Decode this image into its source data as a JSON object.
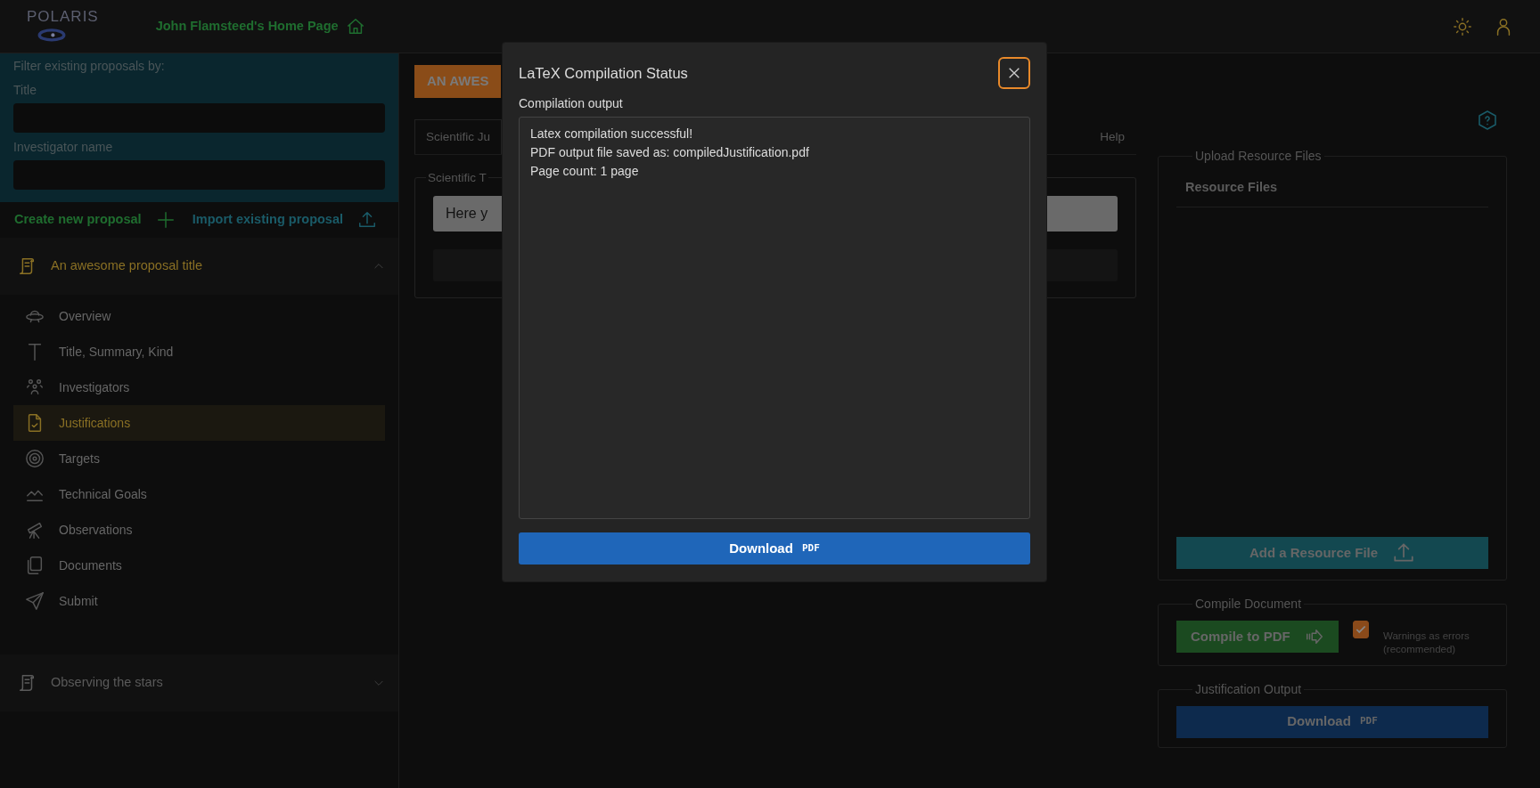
{
  "header": {
    "logo": "POLARIS",
    "home_link": "John Flamsteed's Home Page"
  },
  "filter": {
    "heading": "Filter existing proposals by:",
    "fields": [
      {
        "label": "Title"
      },
      {
        "label": "Investigator name"
      }
    ]
  },
  "actions": [
    {
      "label": "Create new proposal",
      "kind": "create"
    },
    {
      "label": "Import existing proposal",
      "kind": "import"
    }
  ],
  "proposals": [
    {
      "title": "An awesome proposal title",
      "expanded": true,
      "children": [
        {
          "label": "Overview",
          "kind": "ufo",
          "selected": false
        },
        {
          "label": "Title, Summary, Kind",
          "kind": "text",
          "selected": false
        },
        {
          "label": "Investigators",
          "kind": "people",
          "selected": false
        },
        {
          "label": "Justifications",
          "kind": "file-check",
          "selected": true
        },
        {
          "label": "Targets",
          "kind": "target",
          "selected": false
        },
        {
          "label": "Technical Goals",
          "kind": "chart",
          "selected": false
        },
        {
          "label": "Observations",
          "kind": "telescope",
          "selected": false
        },
        {
          "label": "Documents",
          "kind": "copy",
          "selected": false
        },
        {
          "label": "Submit",
          "kind": "send",
          "selected": false
        }
      ]
    },
    {
      "title": "Observing the stars",
      "expanded": false
    }
  ],
  "main": {
    "banner": "AN AWES",
    "tabs": [
      {
        "label": "Scientific Ju",
        "selected": true
      },
      {
        "label": "Help",
        "selected": false
      }
    ],
    "legend": "Scientific T",
    "editor_value": "Here y"
  },
  "resources": {
    "legend": "Upload Resource Files",
    "column": "Resource Files",
    "button": "Add a Resource File"
  },
  "compile": {
    "legend": "Compile Document",
    "button": "Compile to PDF",
    "warnings": {
      "label": "Warnings as errors (recommended)",
      "checked": true
    }
  },
  "output": {
    "legend": "Justification Output",
    "button": "Download",
    "badge": "PDF"
  },
  "modal": {
    "title": "LaTeX Compilation Status",
    "output_label": "Compilation output",
    "output_lines": [
      "Latex compilation successful!",
      "PDF output file saved as: compiledJustification.pdf",
      "Page count: 1 page"
    ],
    "button": "Download",
    "badge": "PDF"
  }
}
